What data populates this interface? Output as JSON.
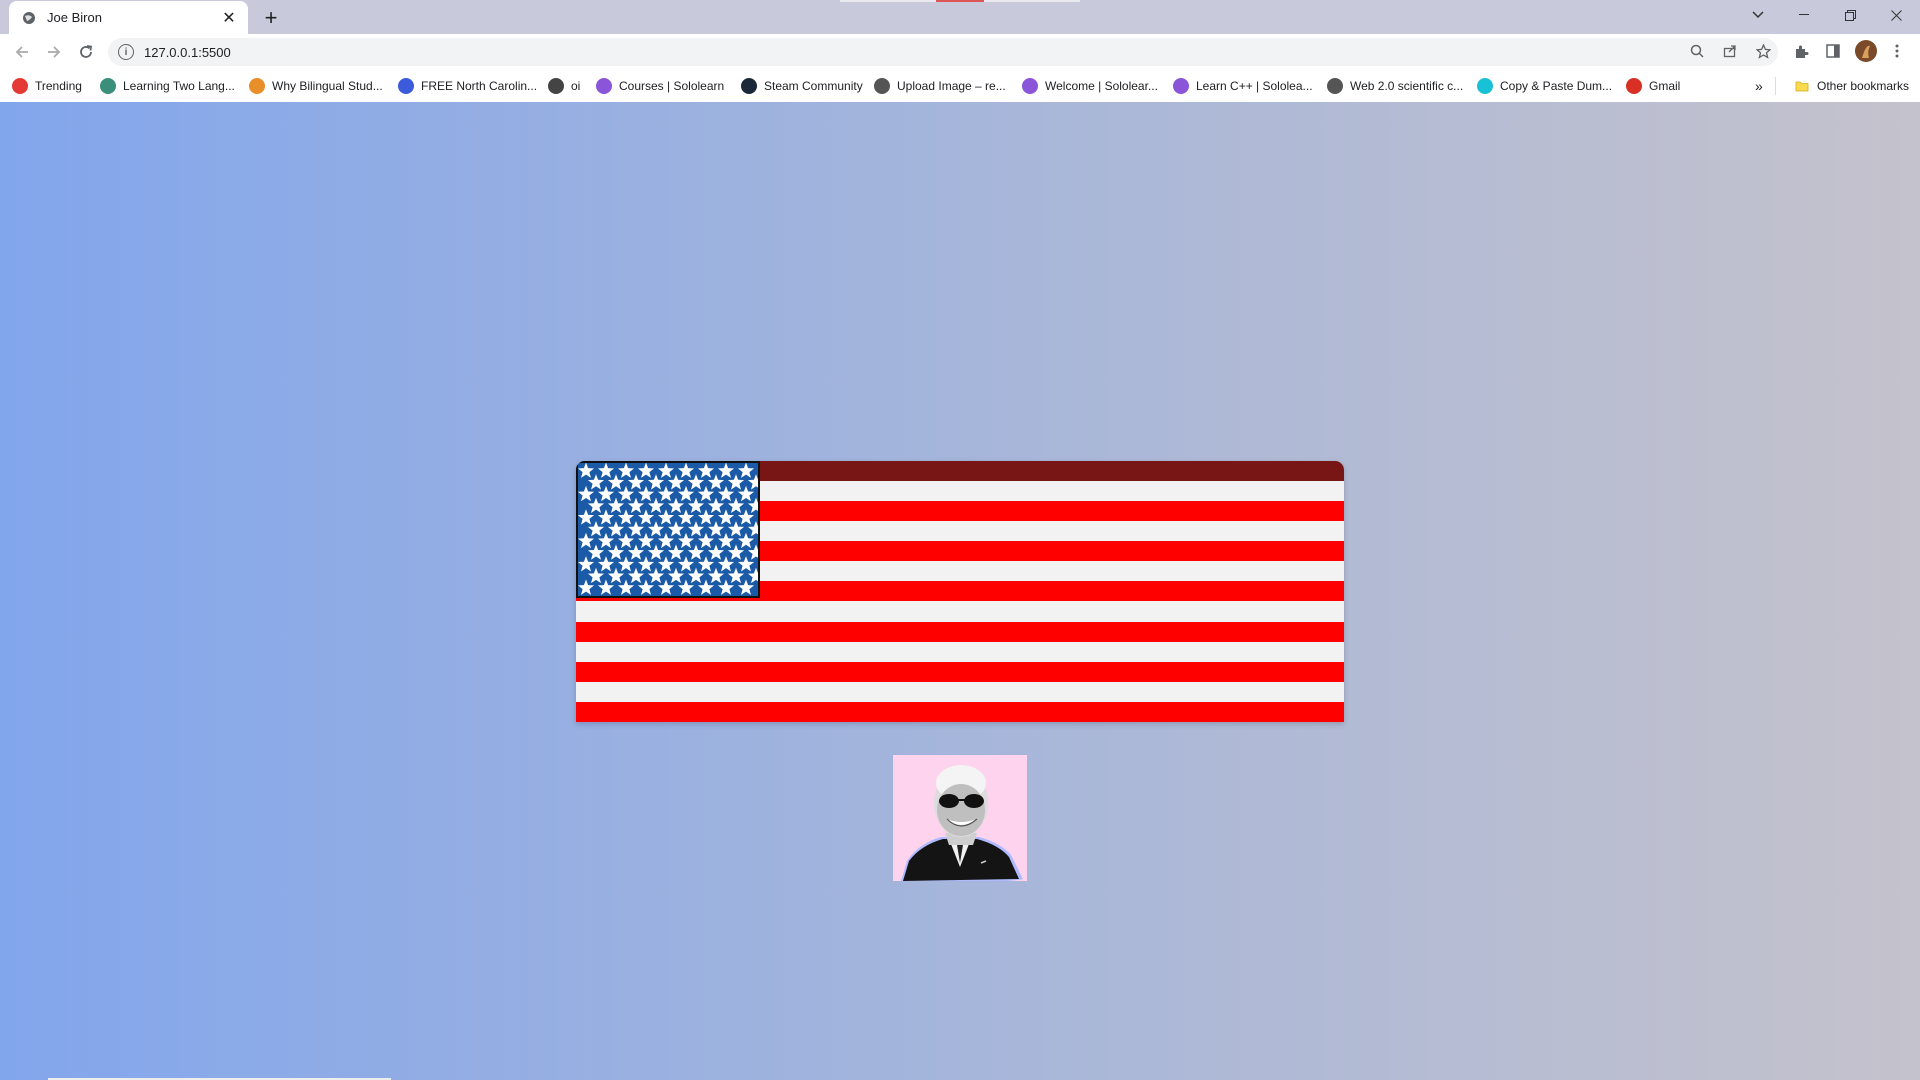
{
  "browser": {
    "tab_title": "Joe Biron",
    "url": "127.0.0.1:5500",
    "new_tab_symbol": "+",
    "close_symbol": "✕"
  },
  "bookmarks": [
    {
      "label": "Trending",
      "icon": "youtube-icon",
      "color": "#e53935"
    },
    {
      "label": "Learning Two Lang...",
      "icon": "globe-icon",
      "color": "#3b8f7a"
    },
    {
      "label": "Why Bilingual Stud...",
      "icon": "star-logo-icon",
      "color": "#e88f2a"
    },
    {
      "label": "FREE North Carolin...",
      "icon": "shield-logo-icon",
      "color": "#3b5bdb"
    },
    {
      "label": "oi",
      "icon": "globe-icon",
      "color": "#444444"
    },
    {
      "label": "Courses | Sololearn",
      "icon": "sololearn-icon",
      "color": "#8a55d9"
    },
    {
      "label": "Steam Community",
      "icon": "steam-icon",
      "color": "#1b2838"
    },
    {
      "label": "Upload Image – re...",
      "icon": "cap-icon",
      "color": "#555555"
    },
    {
      "label": "Welcome | Sololear...",
      "icon": "sololearn-icon",
      "color": "#8a55d9"
    },
    {
      "label": "Learn C++ | Sololea...",
      "icon": "sololearn-icon",
      "color": "#8a55d9"
    },
    {
      "label": "Web 2.0 scientific c...",
      "icon": "calculator-icon",
      "color": "#555555"
    },
    {
      "label": "Copy & Paste Dum...",
      "icon": "copy-logo-icon",
      "color": "#19c1d6"
    },
    {
      "label": "Gmail",
      "icon": "gmail-icon",
      "color": "#d93025"
    }
  ],
  "overflow_label": "»",
  "other_bookmarks": "Other bookmarks",
  "page": {
    "flag": {
      "stripe_red": "#ff0000",
      "stripe_white": "#f2f2f2",
      "top_stripe": "#781515",
      "canton_blue": "#1a5aa6",
      "star_rows": 6,
      "stars_per_row": 9
    },
    "portrait": {
      "alt": "Joe Biden with sunglasses",
      "background": "#fed3ee"
    }
  }
}
